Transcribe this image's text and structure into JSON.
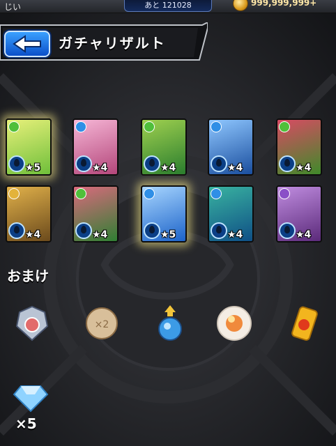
{
  "topbar": {
    "player_name": "じい",
    "exp_remaining": "あと 121028",
    "coin_amount": "999,999,999+"
  },
  "header": {
    "title": "ガチャリザルト",
    "back_icon": "left-arrow-icon"
  },
  "results": [
    {
      "rarity": "★5",
      "highlighted": true,
      "element": "wood",
      "colors": [
        "#6fbf3a",
        "#e7f07a"
      ]
    },
    {
      "rarity": "★4",
      "highlighted": false,
      "element": "water",
      "colors": [
        "#b3467a",
        "#f6b6d6"
      ]
    },
    {
      "rarity": "★4",
      "highlighted": false,
      "element": "wood",
      "colors": [
        "#2a7d2e",
        "#9fd04f"
      ]
    },
    {
      "rarity": "★4",
      "highlighted": false,
      "element": "water",
      "colors": [
        "#1a4e9e",
        "#8fc7ff"
      ]
    },
    {
      "rarity": "★4",
      "highlighted": false,
      "element": "wood",
      "colors": [
        "#3f8a2a",
        "#d84b63"
      ]
    },
    {
      "rarity": "★4",
      "highlighted": false,
      "element": "light",
      "colors": [
        "#6b4a1c",
        "#e1b14a"
      ]
    },
    {
      "rarity": "★4",
      "highlighted": false,
      "element": "wood",
      "colors": [
        "#2f7f33",
        "#d96a7d"
      ]
    },
    {
      "rarity": "★5",
      "highlighted": true,
      "element": "water",
      "colors": [
        "#1c63c9",
        "#a8d6ff"
      ]
    },
    {
      "rarity": "★4",
      "highlighted": false,
      "element": "water",
      "colors": [
        "#0f4f86",
        "#39b3a0"
      ]
    },
    {
      "rarity": "★4",
      "highlighted": false,
      "element": "dark",
      "colors": [
        "#5b2a7a",
        "#c08de0"
      ]
    }
  ],
  "bonus": {
    "label": "おまけ",
    "items": [
      {
        "icon": "silver-medal-icon"
      },
      {
        "icon": "cookie-x2-icon",
        "text": "×2"
      },
      {
        "icon": "blue-orb-potion-icon"
      },
      {
        "icon": "fire-sphere-icon"
      },
      {
        "icon": "fire-can-icon"
      }
    ],
    "gem_icon": "diamond-gem-icon",
    "gem_count": "×5"
  },
  "colors": {
    "background": "#1e1f22",
    "accent_blue": "#0b4fc9"
  }
}
